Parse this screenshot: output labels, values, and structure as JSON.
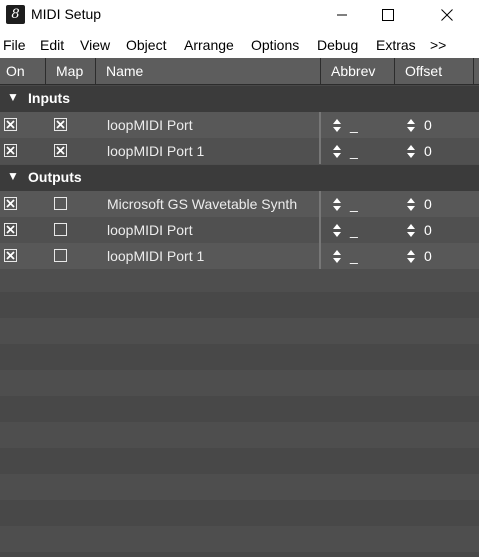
{
  "window": {
    "title": "MIDI Setup",
    "app_icon_glyph": "8",
    "icons": [
      "app-icon",
      "minimize-icon",
      "maximize-icon",
      "close-icon"
    ]
  },
  "menu": [
    "File",
    "Edit",
    "View",
    "Object",
    "Arrange",
    "Options",
    "Debug",
    "Extras",
    ">>"
  ],
  "table": {
    "columns": [
      "On",
      "Map",
      "Name",
      "Abbrev",
      "Offset"
    ],
    "groups": [
      {
        "label": "Inputs",
        "rows": [
          {
            "on": true,
            "map": true,
            "name": "loopMIDI Port",
            "abbrev": "_",
            "offset": "0"
          },
          {
            "on": true,
            "map": true,
            "name": "loopMIDI Port 1",
            "abbrev": "_",
            "offset": "0"
          }
        ]
      },
      {
        "label": "Outputs",
        "rows": [
          {
            "on": true,
            "map": false,
            "name": "Microsoft GS Wavetable Synth",
            "abbrev": "_",
            "offset": "0"
          },
          {
            "on": true,
            "map": false,
            "name": "loopMIDI Port",
            "abbrev": "_",
            "offset": "0"
          },
          {
            "on": true,
            "map": false,
            "name": "loopMIDI Port 1",
            "abbrev": "_",
            "offset": "0"
          }
        ]
      }
    ]
  },
  "colors": {
    "background": "#4e4e4e",
    "header": "#5d5d5d",
    "group": "#3b3b3b",
    "text": "#ffffff"
  }
}
